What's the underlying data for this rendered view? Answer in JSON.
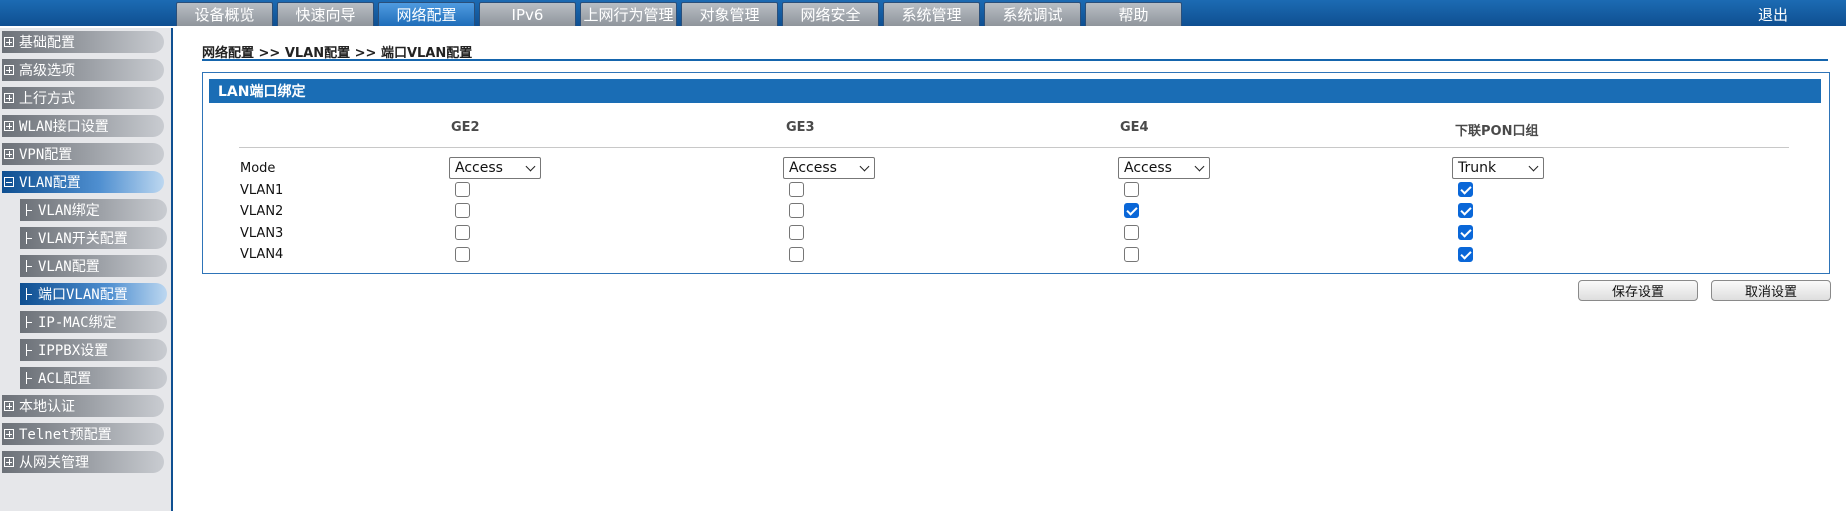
{
  "nav": {
    "tabs": [
      "设备概览",
      "快速向导",
      "网络配置",
      "IPv6",
      "上网行为管理",
      "对象管理",
      "网络安全",
      "系统管理",
      "系统调试",
      "帮助"
    ],
    "active_tab": "网络配置",
    "logout": "退出"
  },
  "sidebar": {
    "items": [
      {
        "label": "基础配置",
        "type": "group",
        "expanded": false
      },
      {
        "label": "高级选项",
        "type": "group",
        "expanded": false
      },
      {
        "label": "上行方式",
        "type": "group",
        "expanded": false
      },
      {
        "label": "WLAN接口设置",
        "type": "group",
        "expanded": false
      },
      {
        "label": "VPN配置",
        "type": "group",
        "expanded": false
      },
      {
        "label": "VLAN配置",
        "type": "group",
        "expanded": true
      },
      {
        "label": "VLAN绑定",
        "type": "sub"
      },
      {
        "label": "VLAN开关配置",
        "type": "sub"
      },
      {
        "label": "VLAN配置",
        "type": "sub"
      },
      {
        "label": "端口VLAN配置",
        "type": "sub",
        "active": true
      },
      {
        "label": "IP-MAC绑定",
        "type": "sub"
      },
      {
        "label": "IPPBX设置",
        "type": "sub"
      },
      {
        "label": "ACL配置",
        "type": "sub"
      },
      {
        "label": "本地认证",
        "type": "group",
        "expanded": false
      },
      {
        "label": "Telnet预配置",
        "type": "group",
        "expanded": false
      },
      {
        "label": "从网关管理",
        "type": "group",
        "expanded": false
      }
    ]
  },
  "breadcrumb": "网络配置 >> VLAN配置 >> 端口VLAN配置",
  "panel": {
    "title": "LAN端口绑定",
    "columns": [
      "GE2",
      "GE3",
      "GE4",
      "下联PON口组"
    ],
    "mode_label": "Mode",
    "modes": [
      "Access",
      "Access",
      "Access",
      "Trunk"
    ],
    "rows": [
      {
        "label": "VLAN1",
        "checked": [
          false,
          false,
          false,
          true
        ]
      },
      {
        "label": "VLAN2",
        "checked": [
          false,
          false,
          true,
          true
        ]
      },
      {
        "label": "VLAN3",
        "checked": [
          false,
          false,
          false,
          true
        ]
      },
      {
        "label": "VLAN4",
        "checked": [
          false,
          false,
          false,
          true
        ]
      }
    ]
  },
  "buttons": {
    "save": "保存设置",
    "cancel": "取消设置"
  },
  "colors": {
    "primary": "#1a6db5",
    "nav_dark": "#0f4f91",
    "checkbox_on": "#0a67d8"
  }
}
